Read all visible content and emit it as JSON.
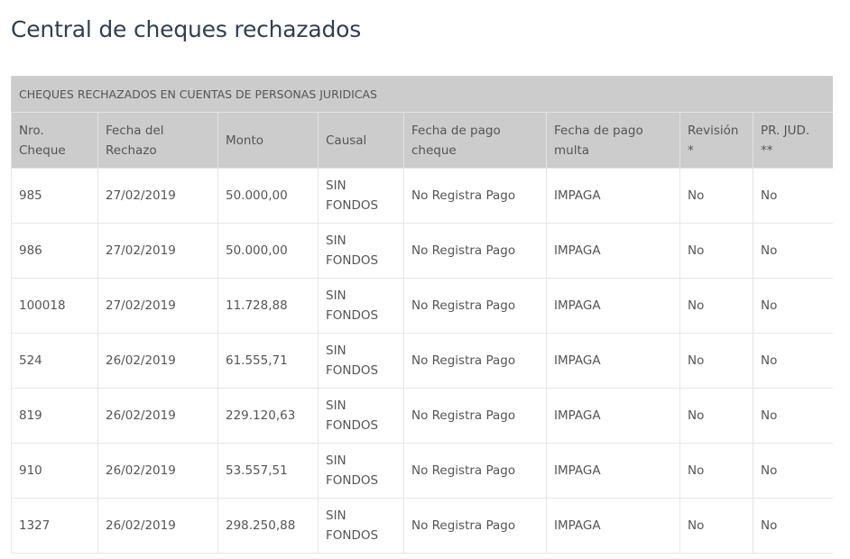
{
  "page": {
    "title": "Central de cheques rechazados"
  },
  "table": {
    "caption": "CHEQUES RECHAZADOS EN CUENTAS DE PERSONAS JURIDICAS",
    "headers": [
      {
        "line1": "Nro.",
        "line2": "Cheque"
      },
      {
        "line1": "Fecha del",
        "line2": "Rechazo"
      },
      {
        "line1": "Monto",
        "line2": ""
      },
      {
        "line1": "Causal",
        "line2": ""
      },
      {
        "line1": "Fecha de pago",
        "line2": "cheque"
      },
      {
        "line1": "Fecha de pago",
        "line2": "multa"
      },
      {
        "line1": "Revisión",
        "line2": "*"
      },
      {
        "line1": "PR. JUD.",
        "line2": "**"
      }
    ],
    "rows": [
      {
        "nro": "985",
        "fecha": "27/02/2019",
        "monto": "50.000,00",
        "causal1": "SIN",
        "causal2": "FONDOS",
        "pago_cheque": "No Registra Pago",
        "pago_multa": "IMPAGA",
        "revision": "No",
        "pr_jud": "No"
      },
      {
        "nro": "986",
        "fecha": "27/02/2019",
        "monto": "50.000,00",
        "causal1": "SIN",
        "causal2": "FONDOS",
        "pago_cheque": "No Registra Pago",
        "pago_multa": "IMPAGA",
        "revision": "No",
        "pr_jud": "No"
      },
      {
        "nro": "100018",
        "fecha": "27/02/2019",
        "monto": "11.728,88",
        "causal1": "SIN",
        "causal2": "FONDOS",
        "pago_cheque": "No Registra Pago",
        "pago_multa": "IMPAGA",
        "revision": "No",
        "pr_jud": "No"
      },
      {
        "nro": "524",
        "fecha": "26/02/2019",
        "monto": "61.555,71",
        "causal1": "SIN",
        "causal2": "FONDOS",
        "pago_cheque": "No Registra Pago",
        "pago_multa": "IMPAGA",
        "revision": "No",
        "pr_jud": "No"
      },
      {
        "nro": "819",
        "fecha": "26/02/2019",
        "monto": "229.120,63",
        "causal1": "SIN",
        "causal2": "FONDOS",
        "pago_cheque": "No Registra Pago",
        "pago_multa": "IMPAGA",
        "revision": "No",
        "pr_jud": "No"
      },
      {
        "nro": "910",
        "fecha": "26/02/2019",
        "monto": "53.557,51",
        "causal1": "SIN",
        "causal2": "FONDOS",
        "pago_cheque": "No Registra Pago",
        "pago_multa": "IMPAGA",
        "revision": "No",
        "pr_jud": "No"
      },
      {
        "nro": "1327",
        "fecha": "26/02/2019",
        "monto": "298.250,88",
        "causal1": "SIN",
        "causal2": "FONDOS",
        "pago_cheque": "No Registra Pago",
        "pago_multa": "IMPAGA",
        "revision": "No",
        "pr_jud": "No"
      }
    ]
  }
}
